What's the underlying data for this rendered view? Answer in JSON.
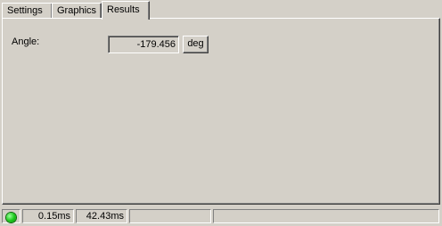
{
  "tabs": [
    {
      "label": "Settings",
      "active": false
    },
    {
      "label": "Graphics",
      "active": false
    },
    {
      "label": "Results",
      "active": true
    }
  ],
  "results": {
    "angle_label": "Angle:",
    "angle_value": "-179.456",
    "unit_button": "deg"
  },
  "statusbar": {
    "led_color": "#1ecc1e",
    "time1": "0.15ms",
    "time2": "42.43ms",
    "pane4": "",
    "pane5": ""
  }
}
